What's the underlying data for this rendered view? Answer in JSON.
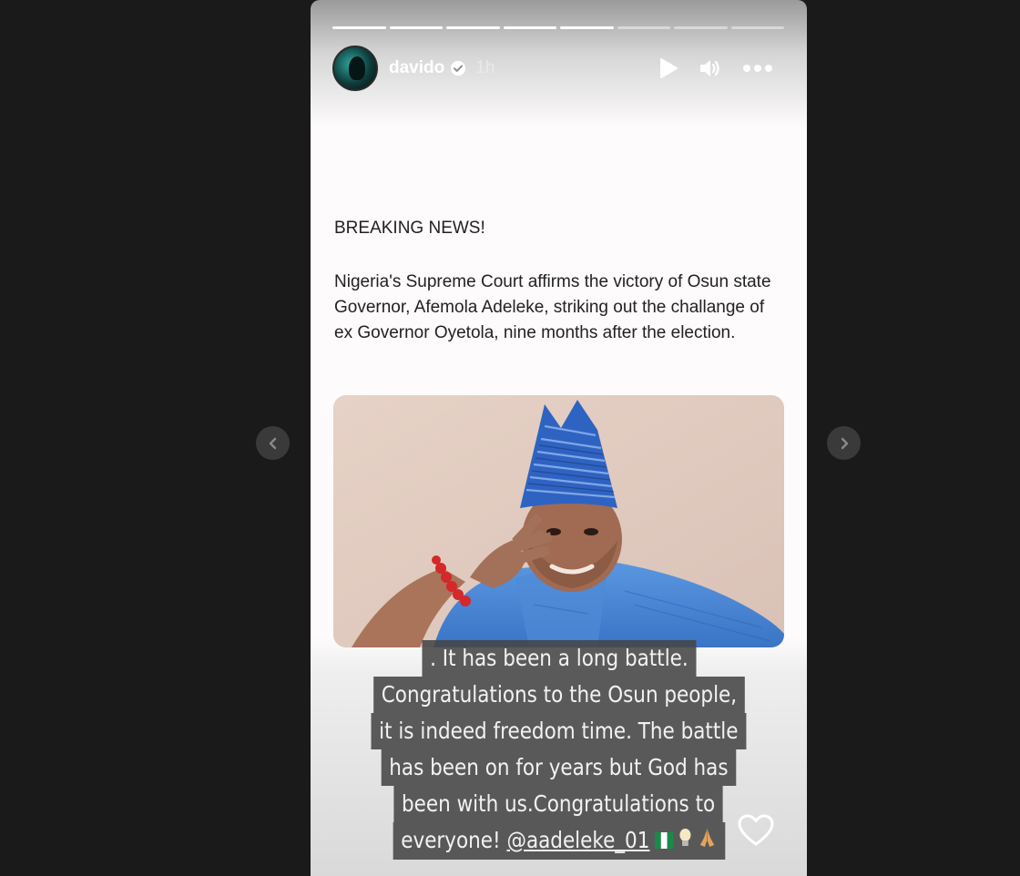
{
  "story": {
    "username": "davido",
    "time": "1h",
    "progress": [
      1,
      1,
      1,
      1,
      1,
      0,
      0,
      0
    ]
  },
  "post": {
    "headline": "BREAKING NEWS!",
    "body": "Nigeria's Supreme Court affirms the victory of Osun state Governor, Afemola Adeleke, striking out the challange of ex Governor Oyetola, nine months after the election."
  },
  "caption": {
    "line1": ". It has been a long battle.",
    "line2": "Congratulations to the Osun people,",
    "line3": "it is indeed freedom time. The battle",
    "line4": "has been on for years but  God has",
    "line5": "been with us.Congratulations to",
    "line6_prefix": "everyone! ",
    "mention": "@aadeleke_01"
  },
  "icons": {
    "play": "play-icon",
    "volume": "volume-icon",
    "more": "more-icon",
    "verified": "verified-badge-icon",
    "like": "heart-icon",
    "prev": "chevron-left-icon",
    "next": "chevron-right-icon",
    "emojis": [
      "nigeria-flag-icon",
      "lightbulb-icon",
      "praying-hands-icon"
    ]
  },
  "colors": {
    "page_background": "#1a1a1a",
    "story_background": "#fdfbfb",
    "caption_background": "#464646",
    "agbada_blue": "#3f7fd0",
    "cap_blue": "#2f63c2"
  }
}
